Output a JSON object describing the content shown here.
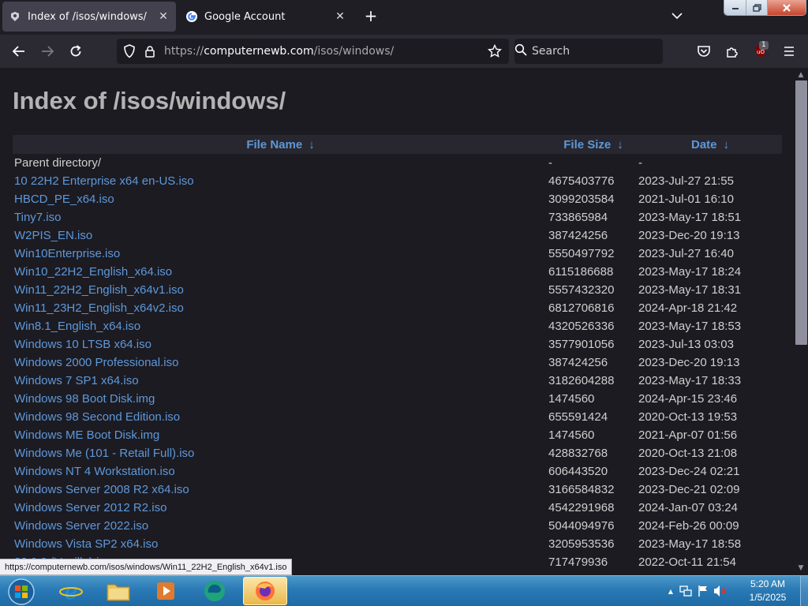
{
  "browser": {
    "tabs": [
      {
        "title": "Index of /isos/windows/",
        "active": true
      },
      {
        "title": "Google Account",
        "active": false
      }
    ],
    "url": {
      "prefix": "https://",
      "host": "computernewb.com",
      "path": "/isos/windows/"
    },
    "search_placeholder": "Search",
    "extension_badge": "1"
  },
  "page": {
    "title": "Index of /isos/windows/",
    "columns": {
      "name": "File Name",
      "size": "File Size",
      "date": "Date",
      "sort_arrow": "↓"
    },
    "parent": {
      "name": "Parent directory/",
      "size": "-",
      "date": "-"
    },
    "files": [
      {
        "name": "10 22H2 Enterprise x64 en-US.iso",
        "size": "4675403776",
        "date": "2023-Jul-27 21:55"
      },
      {
        "name": "HBCD_PE_x64.iso",
        "size": "3099203584",
        "date": "2021-Jul-01 16:10"
      },
      {
        "name": "Tiny7.iso",
        "size": "733865984",
        "date": "2023-May-17 18:51"
      },
      {
        "name": "W2PIS_EN.iso",
        "size": "387424256",
        "date": "2023-Dec-20 19:13"
      },
      {
        "name": "Win10Enterprise.iso",
        "size": "5550497792",
        "date": "2023-Jul-27 16:40"
      },
      {
        "name": "Win10_22H2_English_x64.iso",
        "size": "6115186688",
        "date": "2023-May-17 18:24"
      },
      {
        "name": "Win11_22H2_English_x64v1.iso",
        "size": "5557432320",
        "date": "2023-May-17 18:31"
      },
      {
        "name": "Win11_23H2_English_x64v2.iso",
        "size": "6812706816",
        "date": "2024-Apr-18 21:42"
      },
      {
        "name": "Win8.1_English_x64.iso",
        "size": "4320526336",
        "date": "2023-May-17 18:53"
      },
      {
        "name": "Windows 10 LTSB x64.iso",
        "size": "3577901056",
        "date": "2023-Jul-13 03:03"
      },
      {
        "name": "Windows 2000 Professional.iso",
        "size": "387424256",
        "date": "2023-Dec-20 19:13"
      },
      {
        "name": "Windows 7 SP1 x64.iso",
        "size": "3182604288",
        "date": "2023-May-17 18:33"
      },
      {
        "name": "Windows 98 Boot Disk.img",
        "size": "1474560",
        "date": "2024-Apr-15 23:46"
      },
      {
        "name": "Windows 98 Second Edition.iso",
        "size": "655591424",
        "date": "2020-Oct-13 19:53"
      },
      {
        "name": "Windows ME Boot Disk.img",
        "size": "1474560",
        "date": "2021-Apr-07 01:56"
      },
      {
        "name": "Windows Me (101 - Retail Full).iso",
        "size": "428832768",
        "date": "2020-Oct-13 21:08"
      },
      {
        "name": "Windows NT 4 Workstation.iso",
        "size": "606443520",
        "date": "2023-Dec-24 02:21"
      },
      {
        "name": "Windows Server 2008 R2 x64.iso",
        "size": "3166584832",
        "date": "2023-Dec-21 02:09"
      },
      {
        "name": "Windows Server 2012 R2.iso",
        "size": "4542291968",
        "date": "2024-Jan-07 03:24"
      },
      {
        "name": "Windows Server 2022.iso",
        "size": "5044094976",
        "date": "2024-Feb-26 00:09"
      },
      {
        "name": "Windows Vista SP2 x64.iso",
        "size": "3205953536",
        "date": "2023-May-17 18:58"
      },
      {
        "name": "22.9.9 (Vanilla).iso",
        "size": "717479936",
        "date": "2022-Oct-11 21:54"
      }
    ]
  },
  "status_link": "https://computernewb.com/isos/windows/Win11_22H2_English_x64v1.iso",
  "taskbar": {
    "time": "5:20 AM",
    "date": "1/5/2025",
    "apps": [
      "internet-explorer",
      "file-explorer",
      "media-player",
      "edge-beta",
      "firefox"
    ]
  }
}
